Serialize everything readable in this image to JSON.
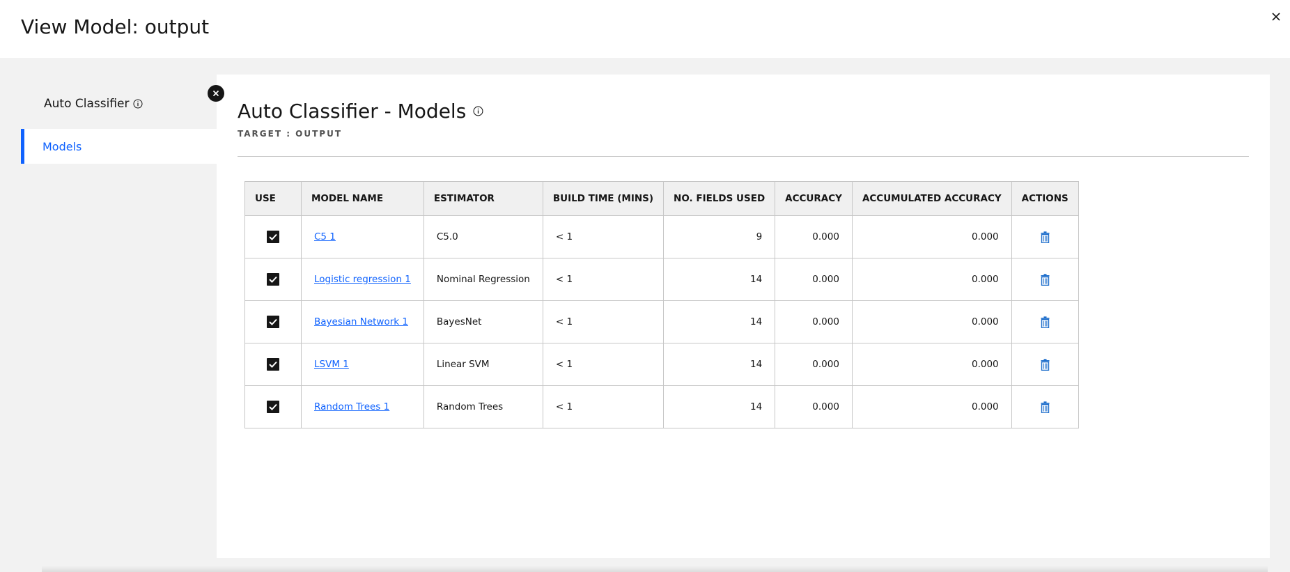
{
  "header": {
    "title": "View Model: output"
  },
  "sidebar": {
    "title": "Auto Classifier",
    "items": [
      {
        "label": "Models"
      }
    ]
  },
  "main": {
    "title": "Auto Classifier - Models",
    "target": "TARGET : OUTPUT"
  },
  "table": {
    "headers": [
      "USE",
      "MODEL NAME",
      "ESTIMATOR",
      "BUILD TIME (MINS)",
      "NO. FIELDS USED",
      "ACCURACY",
      "ACCUMULATED ACCURACY",
      "ACTIONS"
    ],
    "rows": [
      {
        "use": true,
        "model_name": "C5 1",
        "estimator": "C5.0",
        "build_time": "< 1",
        "fields_used": "9",
        "accuracy": "0.000",
        "accumulated_accuracy": "0.000"
      },
      {
        "use": true,
        "model_name": "Logistic regression 1",
        "estimator": "Nominal Regression",
        "build_time": "< 1",
        "fields_used": "14",
        "accuracy": "0.000",
        "accumulated_accuracy": "0.000"
      },
      {
        "use": true,
        "model_name": "Bayesian Network 1",
        "estimator": "BayesNet",
        "build_time": "< 1",
        "fields_used": "14",
        "accuracy": "0.000",
        "accumulated_accuracy": "0.000"
      },
      {
        "use": true,
        "model_name": "LSVM 1",
        "estimator": "Linear SVM",
        "build_time": "< 1",
        "fields_used": "14",
        "accuracy": "0.000",
        "accumulated_accuracy": "0.000"
      },
      {
        "use": true,
        "model_name": "Random Trees 1",
        "estimator": "Random Trees",
        "build_time": "< 1",
        "fields_used": "14",
        "accuracy": "0.000",
        "accumulated_accuracy": "0.000"
      }
    ]
  },
  "icons": {
    "close": "close-icon",
    "info": "info-icon",
    "collapse": "collapse-close-icon",
    "checkbox": "checkbox-checked-icon",
    "delete": "trash-icon"
  },
  "colors": {
    "accent": "#0f62fe",
    "trash": "#1f6fcc",
    "text": "#161616"
  }
}
